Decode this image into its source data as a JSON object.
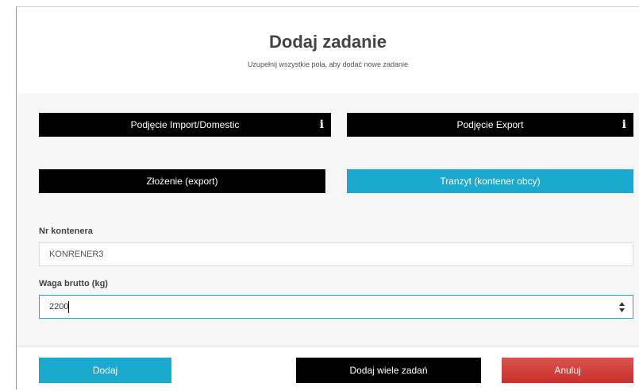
{
  "modal": {
    "title": "Dodaj zadanie",
    "subtitle": "Uzupełnij wszystkie pola, aby dodać nowe zadanie"
  },
  "task_types": [
    {
      "label": "Podjęcie Import/Domestic",
      "info_icon": "info-icon",
      "selected": false
    },
    {
      "label": "Podjęcie Export",
      "info_icon": "info-icon",
      "selected": false
    },
    {
      "label": "Złożenie (export)",
      "selected": false
    },
    {
      "label": "Tranzyt (kontener obcy)",
      "selected": true
    }
  ],
  "fields": {
    "container_number": {
      "label": "Nr kontenera",
      "value": "KONRENER3"
    },
    "gross_weight": {
      "label": "Waga brutto (kg)",
      "value": "2200"
    }
  },
  "footer": {
    "add_label": "Dodaj",
    "add_many_label": "Dodaj wiele zadań",
    "cancel_label": "Anuluj"
  },
  "colors": {
    "accent": "#1ba9cf",
    "dark": "#000000",
    "danger": "#d9534f"
  }
}
